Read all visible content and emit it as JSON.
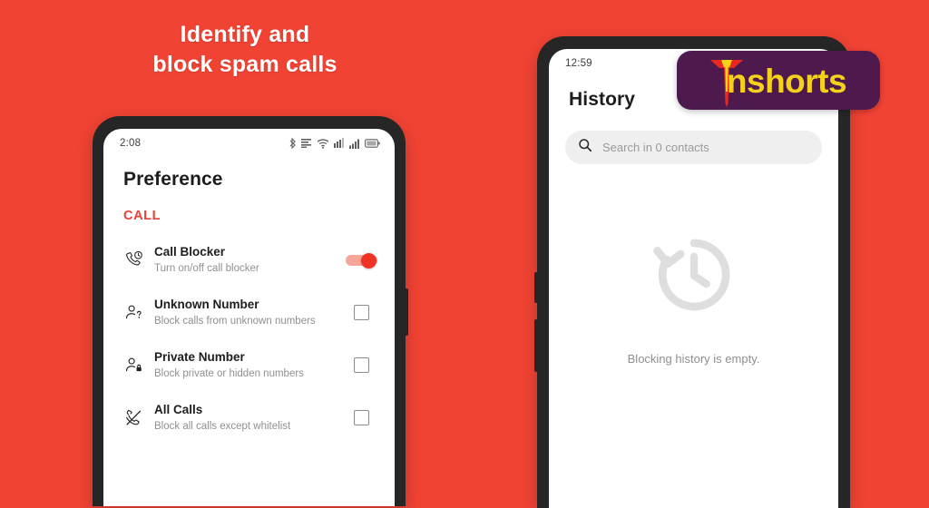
{
  "background_color": "#f14334",
  "headline": {
    "line1": "Identify and",
    "line2": "block spam calls"
  },
  "watermark": {
    "label": "nshorts",
    "badge_color": "#4e1a4e",
    "text_color": "#f5d11a",
    "mark_color": "#e8281e"
  },
  "phone_left": {
    "status_bar": {
      "clock": "2:08",
      "icons": [
        "bluetooth-icon",
        "data-rate-icon",
        "wifi-icon",
        "mobile-data-icon",
        "signal-icon",
        "battery-icon"
      ]
    },
    "title": "Preference",
    "section_label": "CALL",
    "section_color": "#ef3d35",
    "items": [
      {
        "icon": "call-blocker-icon",
        "title": "Call Blocker",
        "subtitle": "Turn on/off call blocker",
        "control": "toggle",
        "state": "on"
      },
      {
        "icon": "unknown-number-icon",
        "title": "Unknown Number",
        "subtitle": "Block calls from unknown numbers",
        "control": "checkbox",
        "state": "off"
      },
      {
        "icon": "private-number-icon",
        "title": "Private Number",
        "subtitle": "Block private or hidden numbers",
        "control": "checkbox",
        "state": "off"
      },
      {
        "icon": "all-calls-icon",
        "title": "All Calls",
        "subtitle": "Block all calls except whitelist",
        "control": "checkbox",
        "state": "off"
      }
    ]
  },
  "phone_right": {
    "status_bar": {
      "clock": "12:59"
    },
    "title": "History",
    "search": {
      "icon": "search-icon",
      "placeholder": "Search in 0 contacts"
    },
    "empty_state": {
      "icon": "history-icon",
      "message": "Blocking history is empty."
    }
  }
}
